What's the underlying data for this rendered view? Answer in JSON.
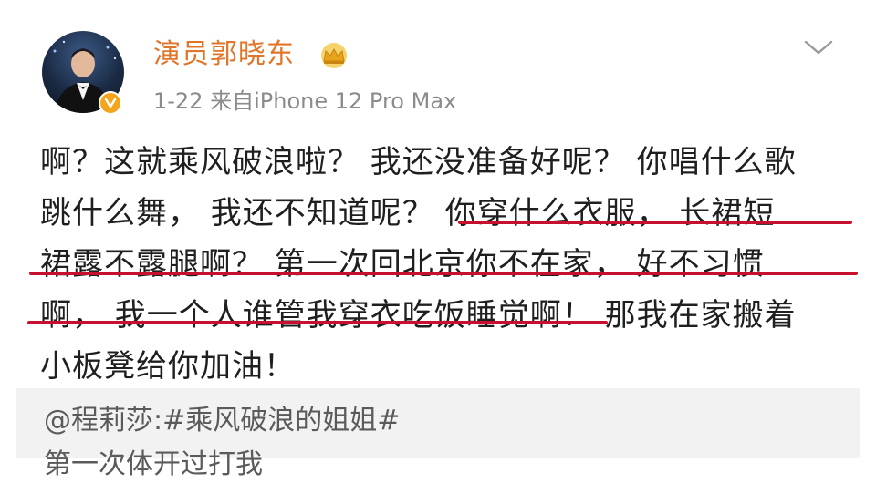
{
  "post": {
    "author": "演员郭晓东",
    "date": "1-22",
    "source": "来自iPhone 12 Pro Max",
    "lines": [
      "啊？这就乘风破浪啦？ 我还没准备好呢？ 你唱什么歌",
      "跳什么舞， 我还不知道呢？ 你穿什么衣服， 长裙短",
      "裙露不露腿啊？ 第一次回北京你不在家， 好不习惯",
      "啊， 我一个人谁管我穿衣吃饭睡觉啊！ 那我在家搬着",
      "小板凳给你加油！"
    ],
    "underline_color": "#c8102e"
  },
  "repost": {
    "mention": "@程莉莎:#乘风破浪的姐姐#",
    "cut_text": "第一次体开过打我"
  },
  "icons": {
    "crown": "crown-icon",
    "more": "chevron-down-icon",
    "verify": "verified-badge-icon"
  },
  "colors": {
    "username": "#e0762a",
    "meta": "#8b8b8b",
    "repost_bg": "#f2f2f2"
  }
}
